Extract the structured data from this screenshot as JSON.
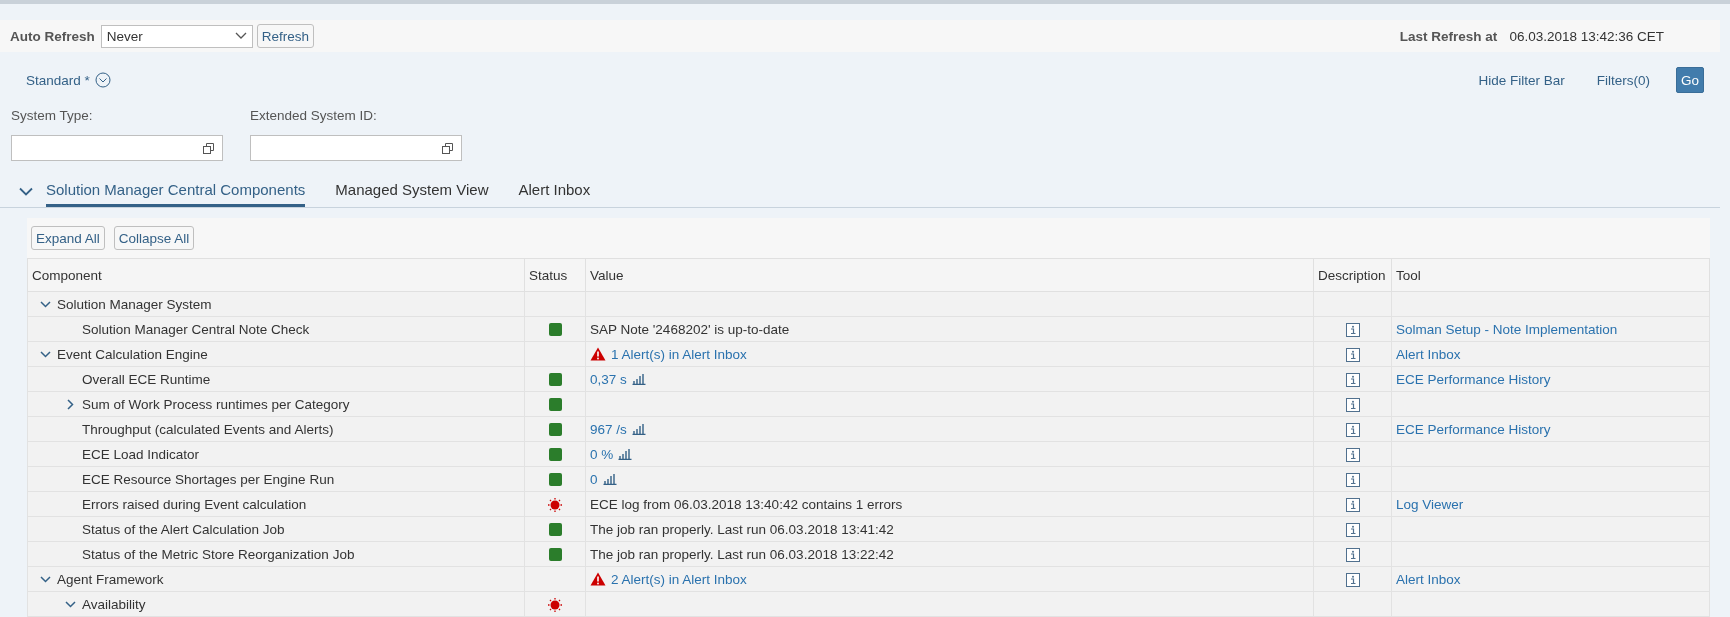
{
  "toolbar": {
    "auto_refresh_label": "Auto Refresh",
    "auto_refresh_value": "Never",
    "refresh_button": "Refresh",
    "last_refresh_label": "Last Refresh at",
    "last_refresh_value": "06.03.2018 13:42:36 CET"
  },
  "variant": {
    "name": "Standard *"
  },
  "filter_actions": [
    "Hide Filter Bar",
    "Filters(0)"
  ],
  "go_button": "Go",
  "filters": [
    {
      "label": "System Type:"
    },
    {
      "label": "Extended System ID:"
    }
  ],
  "tabs": [
    {
      "label": "Solution Manager Central Components",
      "selected": true
    },
    {
      "label": "Managed System View",
      "selected": false
    },
    {
      "label": "Alert Inbox",
      "selected": false
    }
  ],
  "table_buttons": [
    "Expand All",
    "Collapse All"
  ],
  "table": {
    "columns": [
      "Component",
      "Status",
      "Value",
      "Description",
      "Tool"
    ],
    "rows": [
      {
        "component": "Solution Manager System",
        "expanded": true,
        "children": [
          {
            "component": "Solution Manager Central Note Check",
            "error": false,
            "value": {
              "kind": "text",
              "text": "SAP Note '2468202' is up-to-date"
            },
            "info": true,
            "tool": "Solman Setup - Note Implementation"
          }
        ]
      },
      {
        "component": "Event Calculation Engine",
        "expanded": true,
        "value": {
          "kind": "alert",
          "text": "1 Alert(s) in Alert Inbox"
        },
        "info": true,
        "tool": "Alert Inbox",
        "children": [
          {
            "component": "Overall ECE Runtime",
            "error": false,
            "value": {
              "kind": "metric",
              "text": "0,37 s"
            },
            "info": true,
            "tool": "ECE Performance History"
          },
          {
            "component": "Sum of Work Process runtimes per Category",
            "expanded": false,
            "error": false,
            "info": true
          },
          {
            "component": "Throughput (calculated Events and Alerts)",
            "error": false,
            "value": {
              "kind": "metric",
              "text": "967 /s"
            },
            "info": true,
            "tool": "ECE Performance History"
          },
          {
            "component": "ECE Load Indicator",
            "error": false,
            "value": {
              "kind": "metric",
              "text": "0 %"
            },
            "info": true
          },
          {
            "component": "ECE Resource Shortages per Engine Run",
            "error": false,
            "value": {
              "kind": "metric",
              "text": "0"
            },
            "info": true
          },
          {
            "component": "Errors raised during Event calculation",
            "error": true,
            "value": {
              "kind": "text",
              "text": "ECE log from 06.03.2018 13:40:42 contains 1 errors"
            },
            "info": true,
            "tool": "Log Viewer"
          },
          {
            "component": "Status of the Alert Calculation Job",
            "error": false,
            "value": {
              "kind": "text",
              "text": "The job ran properly. Last run 06.03.2018 13:41:42"
            },
            "info": true
          },
          {
            "component": "Status of the Metric Store Reorganization Job",
            "error": false,
            "value": {
              "kind": "text",
              "text": "The job ran properly. Last run 06.03.2018 13:22:42"
            },
            "info": true
          }
        ]
      },
      {
        "component": "Agent Framework",
        "expanded": true,
        "value": {
          "kind": "alert",
          "text": "2 Alert(s) in Alert Inbox"
        },
        "info": true,
        "tool": "Alert Inbox",
        "children": [
          {
            "component": "Availability",
            "expanded": true,
            "error": true
          }
        ]
      }
    ]
  }
}
